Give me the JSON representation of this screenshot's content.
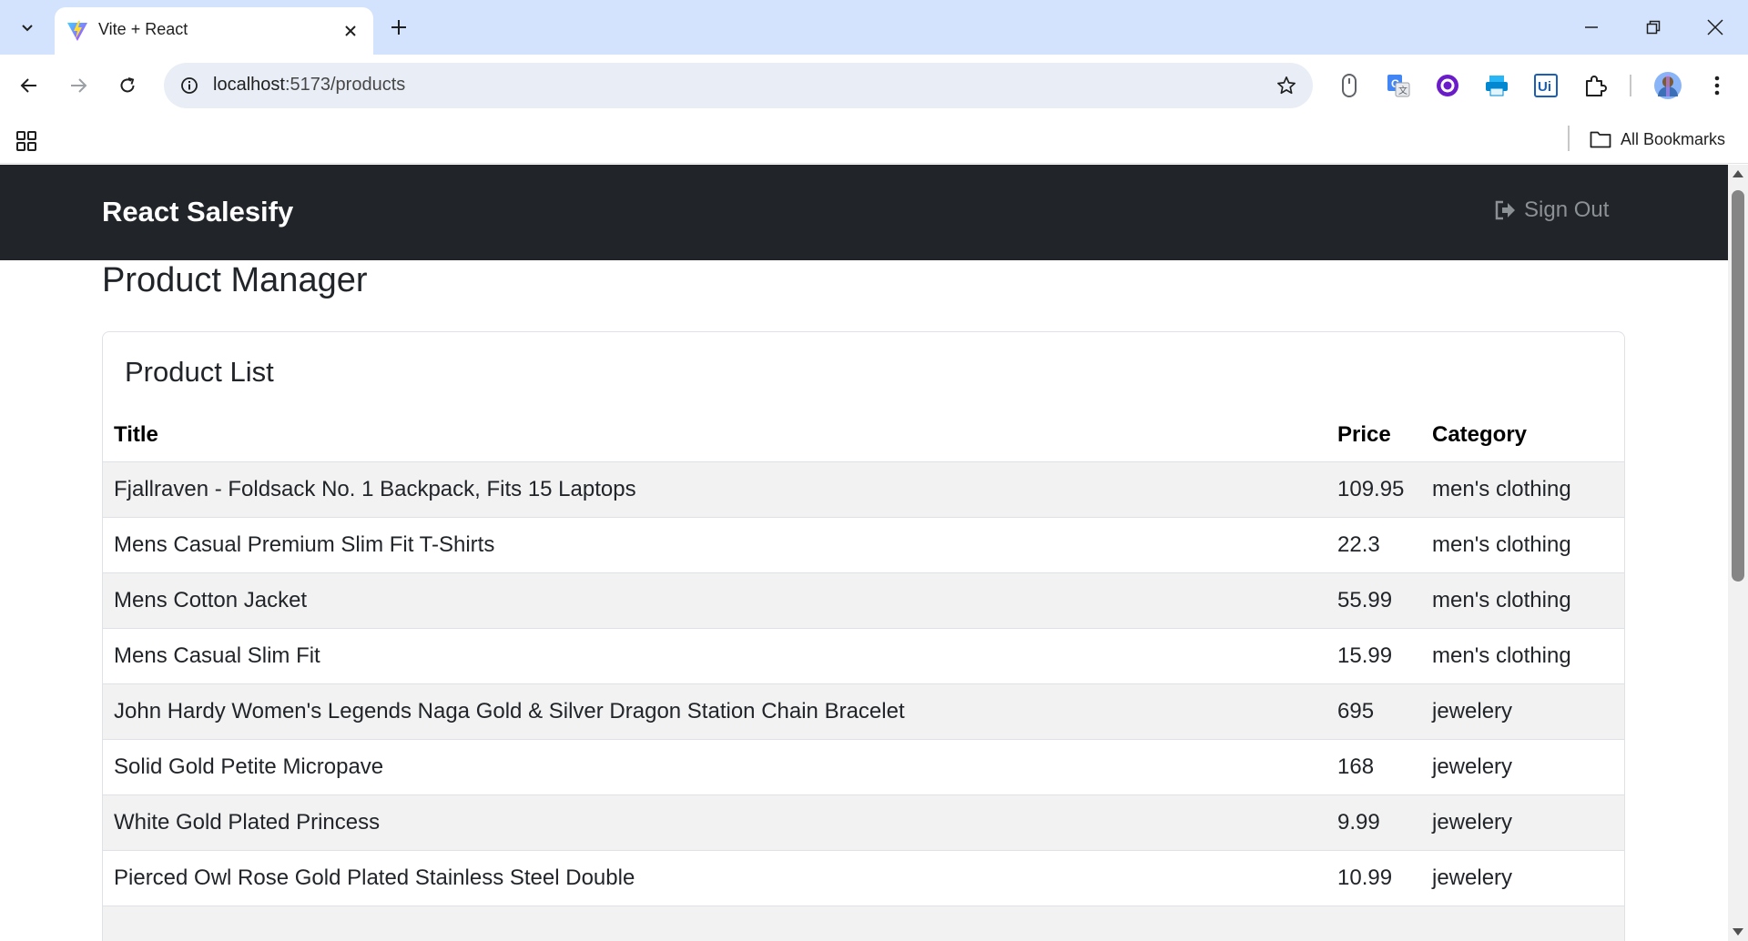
{
  "browser": {
    "tab_title": "Vite + React",
    "url_host": "localhost",
    "url_path": ":5173/products",
    "bookmarks_label": "All Bookmarks"
  },
  "app": {
    "brand": "React Salesify",
    "signout_label": "Sign Out",
    "page_title": "Product Manager",
    "card_title": "Product List"
  },
  "table": {
    "headers": [
      "Title",
      "Price",
      "Category"
    ],
    "rows": [
      {
        "title": "Fjallraven - Foldsack No. 1 Backpack, Fits 15 Laptops",
        "price": "109.95",
        "category": "men's clothing"
      },
      {
        "title": "Mens Casual Premium Slim Fit T-Shirts",
        "price": "22.3",
        "category": "men's clothing"
      },
      {
        "title": "Mens Cotton Jacket",
        "price": "55.99",
        "category": "men's clothing"
      },
      {
        "title": "Mens Casual Slim Fit",
        "price": "15.99",
        "category": "men's clothing"
      },
      {
        "title": "John Hardy Women's Legends Naga Gold & Silver Dragon Station Chain Bracelet",
        "price": "695",
        "category": "jewelery"
      },
      {
        "title": "Solid Gold Petite Micropave",
        "price": "168",
        "category": "jewelery"
      },
      {
        "title": "White Gold Plated Princess",
        "price": "9.99",
        "category": "jewelery"
      },
      {
        "title": "Pierced Owl Rose Gold Plated Stainless Steel Double",
        "price": "10.99",
        "category": "jewelery"
      }
    ]
  },
  "colors": {
    "navbar_bg": "#212529",
    "tabbar_bg": "#d3e3fd",
    "stripe_row": "#f2f2f2"
  },
  "icons": [
    "tab-search-icon",
    "vite-favicon",
    "close-icon",
    "plus-icon",
    "minimize-icon",
    "restore-icon",
    "window-close-icon",
    "back-arrow-icon",
    "forward-arrow-icon",
    "reload-icon",
    "site-info-icon",
    "star-icon",
    "extension-icon",
    "puzzle-icon",
    "profile-avatar",
    "more-vert-icon",
    "apps-grid-icon",
    "folder-icon",
    "sign-out-icon"
  ]
}
